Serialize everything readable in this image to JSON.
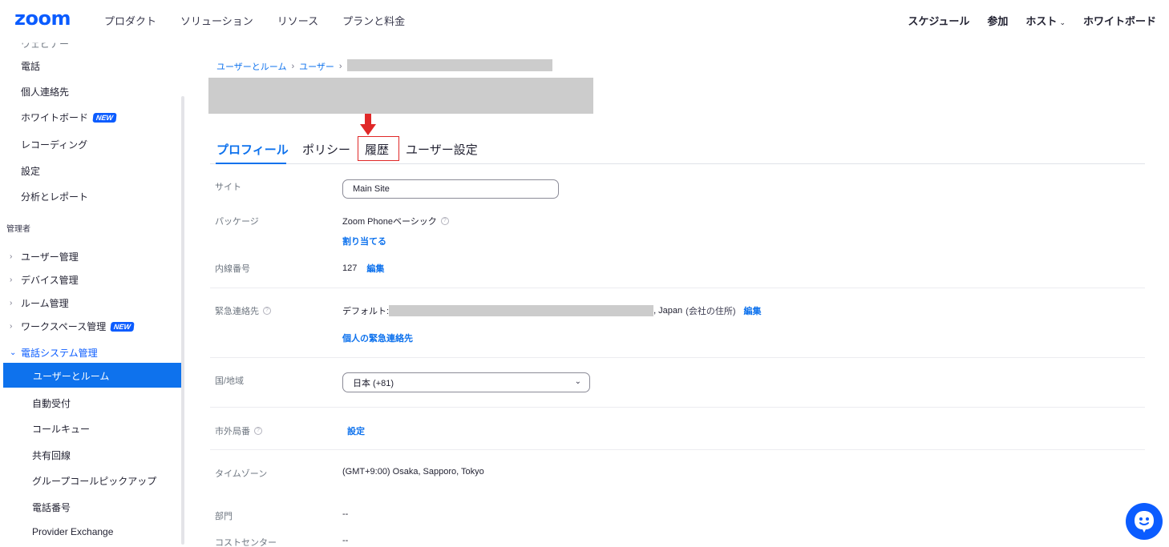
{
  "topnav": {
    "logo": "zoom",
    "left": [
      "プロダクト",
      "ソリューション",
      "リソース",
      "プランと料金"
    ],
    "right": {
      "schedule": "スケジュール",
      "join": "参加",
      "host": "ホスト",
      "whiteboard": "ホワイトボード"
    }
  },
  "sidebar": {
    "partial_top": "ウェビナー",
    "items": [
      "電話",
      "個人連絡先",
      "ホワイトボード",
      "レコーディング",
      "設定",
      "分析とレポート"
    ],
    "new_badge": "NEW",
    "admin_section": "管理者",
    "groups": [
      "ユーザー管理",
      "デバイス管理",
      "ルーム管理",
      "ワークスペース管理",
      "電話システム管理"
    ],
    "phone_sub": [
      "ユーザーとルーム",
      "自動受付",
      "コールキュー",
      "共有回線",
      "グループコールピックアップ",
      "電話番号",
      "Provider Exchange"
    ]
  },
  "breadcrumb": {
    "level1": "ユーザーとルーム",
    "level2": "ユーザー"
  },
  "tabs": [
    "プロフィール",
    "ポリシー",
    "履歴",
    "ユーザー設定"
  ],
  "profile": {
    "site_label": "サイト",
    "site_value": "Main Site",
    "package_label": "パッケージ",
    "package_value": "Zoom Phoneベーシック",
    "assign_link": "割り当てる",
    "extension_label": "内線番号",
    "extension_value": "127",
    "edit_link": "編集",
    "emergency_label": "緊急連絡先",
    "emergency_prefix": "デフォルト:",
    "emergency_suffix": ", Japan",
    "emergency_note": "(会社の住所)",
    "personal_emergency_link": "個人の緊急連絡先",
    "country_label": "国/地域",
    "country_value": "日本 (+81)",
    "area_code_label": "市外局番",
    "area_code_link": "設定",
    "timezone_label": "タイムゾーン",
    "timezone_value": "(GMT+9:00) Osaka, Sapporo, Tokyo",
    "department_label": "部門",
    "department_value": "--",
    "cost_center_label": "コストセンター",
    "cost_center_value": "--"
  },
  "colors": {
    "brand": "#0b5cff",
    "active_nav": "#0e72ed",
    "annotation_red": "#e02828"
  }
}
